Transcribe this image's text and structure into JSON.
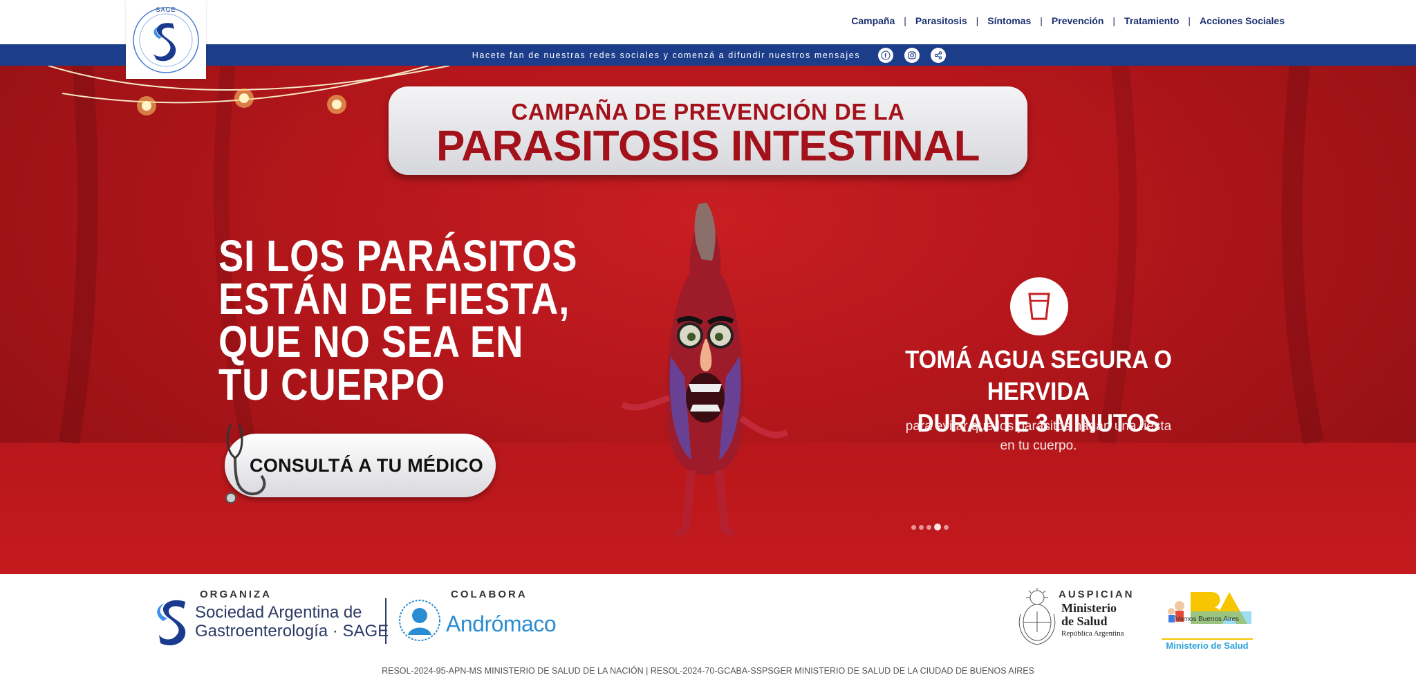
{
  "header": {
    "logo_text_top": "SAGE",
    "logo_text_ring": "Sociedad Argentina de Gastroenterología",
    "nav": [
      {
        "label": "Campaña"
      },
      {
        "label": "Parasitosis"
      },
      {
        "label": "Síntomas"
      },
      {
        "label": "Prevención"
      },
      {
        "label": "Tratamiento"
      },
      {
        "label": "Acciones Sociales"
      }
    ],
    "separator": "|"
  },
  "social_bar": {
    "text": "Hacete fan de nuestras redes sociales y comenzá a difundir nuestros mensajes",
    "icons": [
      "facebook-icon",
      "instagram-icon",
      "share-icon"
    ],
    "color": "#1c3d8a"
  },
  "hero": {
    "title_top": "CAMPAÑA DE PREVENCIÓN DE LA",
    "title_main": "PARASITOSIS INTESTINAL",
    "slogan": [
      "SI LOS PARÁSITOS",
      "ESTÁN DE FIESTA,",
      "QUE NO SEA EN",
      "TU CUERPO"
    ],
    "cta": "CONSULTÁ A TU MÉDICO",
    "tip_title": [
      "TOMÁ AGUA SEGURA O HERVIDA",
      "DURANTE 3 MINUTOS"
    ],
    "tip_body": [
      "para evitar que los parásitos hagan una fiesta",
      "en tu cuerpo."
    ],
    "slides": 5,
    "active_slide": 3,
    "accent": "#a3111a"
  },
  "footer": {
    "organiza_label": "ORGANIZA",
    "sage_name": [
      "Sociedad Argentina de",
      "Gastroenterología · SAGE"
    ],
    "colabora_label": "COLABORA",
    "andromaco": "Andrómaco",
    "auspician_label": "AUSPICIAN",
    "ministerio": [
      "Ministerio",
      "de Salud",
      "República Argentina"
    ],
    "ba_tagline": "Vamos Buenos Aires",
    "ba_ministerio": "Ministerio de Salud",
    "resol": "RESOL-2024-95-APN-MS MINISTERIO DE SALUD DE LA NACIÓN | RESOL-2024-70-GCABA-SSPSGER MINISTERIO DE SALUD DE LA CIUDAD DE BUENOS AIRES"
  }
}
